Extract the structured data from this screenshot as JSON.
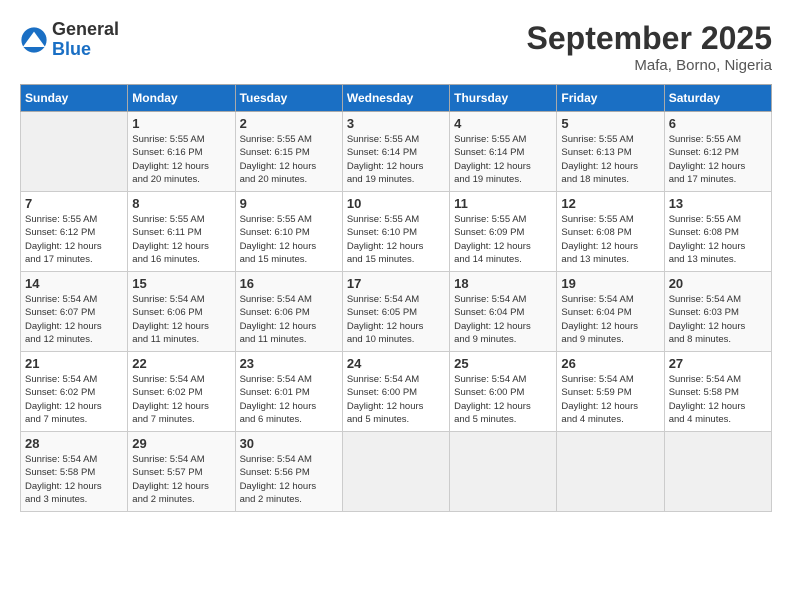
{
  "header": {
    "logo_general": "General",
    "logo_blue": "Blue",
    "month_title": "September 2025",
    "location": "Mafa, Borno, Nigeria"
  },
  "days_of_week": [
    "Sunday",
    "Monday",
    "Tuesday",
    "Wednesday",
    "Thursday",
    "Friday",
    "Saturday"
  ],
  "weeks": [
    [
      {
        "day": "",
        "info": ""
      },
      {
        "day": "1",
        "info": "Sunrise: 5:55 AM\nSunset: 6:16 PM\nDaylight: 12 hours\nand 20 minutes."
      },
      {
        "day": "2",
        "info": "Sunrise: 5:55 AM\nSunset: 6:15 PM\nDaylight: 12 hours\nand 20 minutes."
      },
      {
        "day": "3",
        "info": "Sunrise: 5:55 AM\nSunset: 6:14 PM\nDaylight: 12 hours\nand 19 minutes."
      },
      {
        "day": "4",
        "info": "Sunrise: 5:55 AM\nSunset: 6:14 PM\nDaylight: 12 hours\nand 19 minutes."
      },
      {
        "day": "5",
        "info": "Sunrise: 5:55 AM\nSunset: 6:13 PM\nDaylight: 12 hours\nand 18 minutes."
      },
      {
        "day": "6",
        "info": "Sunrise: 5:55 AM\nSunset: 6:12 PM\nDaylight: 12 hours\nand 17 minutes."
      }
    ],
    [
      {
        "day": "7",
        "info": "Sunrise: 5:55 AM\nSunset: 6:12 PM\nDaylight: 12 hours\nand 17 minutes."
      },
      {
        "day": "8",
        "info": "Sunrise: 5:55 AM\nSunset: 6:11 PM\nDaylight: 12 hours\nand 16 minutes."
      },
      {
        "day": "9",
        "info": "Sunrise: 5:55 AM\nSunset: 6:10 PM\nDaylight: 12 hours\nand 15 minutes."
      },
      {
        "day": "10",
        "info": "Sunrise: 5:55 AM\nSunset: 6:10 PM\nDaylight: 12 hours\nand 15 minutes."
      },
      {
        "day": "11",
        "info": "Sunrise: 5:55 AM\nSunset: 6:09 PM\nDaylight: 12 hours\nand 14 minutes."
      },
      {
        "day": "12",
        "info": "Sunrise: 5:55 AM\nSunset: 6:08 PM\nDaylight: 12 hours\nand 13 minutes."
      },
      {
        "day": "13",
        "info": "Sunrise: 5:55 AM\nSunset: 6:08 PM\nDaylight: 12 hours\nand 13 minutes."
      }
    ],
    [
      {
        "day": "14",
        "info": "Sunrise: 5:54 AM\nSunset: 6:07 PM\nDaylight: 12 hours\nand 12 minutes."
      },
      {
        "day": "15",
        "info": "Sunrise: 5:54 AM\nSunset: 6:06 PM\nDaylight: 12 hours\nand 11 minutes."
      },
      {
        "day": "16",
        "info": "Sunrise: 5:54 AM\nSunset: 6:06 PM\nDaylight: 12 hours\nand 11 minutes."
      },
      {
        "day": "17",
        "info": "Sunrise: 5:54 AM\nSunset: 6:05 PM\nDaylight: 12 hours\nand 10 minutes."
      },
      {
        "day": "18",
        "info": "Sunrise: 5:54 AM\nSunset: 6:04 PM\nDaylight: 12 hours\nand 9 minutes."
      },
      {
        "day": "19",
        "info": "Sunrise: 5:54 AM\nSunset: 6:04 PM\nDaylight: 12 hours\nand 9 minutes."
      },
      {
        "day": "20",
        "info": "Sunrise: 5:54 AM\nSunset: 6:03 PM\nDaylight: 12 hours\nand 8 minutes."
      }
    ],
    [
      {
        "day": "21",
        "info": "Sunrise: 5:54 AM\nSunset: 6:02 PM\nDaylight: 12 hours\nand 7 minutes."
      },
      {
        "day": "22",
        "info": "Sunrise: 5:54 AM\nSunset: 6:02 PM\nDaylight: 12 hours\nand 7 minutes."
      },
      {
        "day": "23",
        "info": "Sunrise: 5:54 AM\nSunset: 6:01 PM\nDaylight: 12 hours\nand 6 minutes."
      },
      {
        "day": "24",
        "info": "Sunrise: 5:54 AM\nSunset: 6:00 PM\nDaylight: 12 hours\nand 5 minutes."
      },
      {
        "day": "25",
        "info": "Sunrise: 5:54 AM\nSunset: 6:00 PM\nDaylight: 12 hours\nand 5 minutes."
      },
      {
        "day": "26",
        "info": "Sunrise: 5:54 AM\nSunset: 5:59 PM\nDaylight: 12 hours\nand 4 minutes."
      },
      {
        "day": "27",
        "info": "Sunrise: 5:54 AM\nSunset: 5:58 PM\nDaylight: 12 hours\nand 4 minutes."
      }
    ],
    [
      {
        "day": "28",
        "info": "Sunrise: 5:54 AM\nSunset: 5:58 PM\nDaylight: 12 hours\nand 3 minutes."
      },
      {
        "day": "29",
        "info": "Sunrise: 5:54 AM\nSunset: 5:57 PM\nDaylight: 12 hours\nand 2 minutes."
      },
      {
        "day": "30",
        "info": "Sunrise: 5:54 AM\nSunset: 5:56 PM\nDaylight: 12 hours\nand 2 minutes."
      },
      {
        "day": "",
        "info": ""
      },
      {
        "day": "",
        "info": ""
      },
      {
        "day": "",
        "info": ""
      },
      {
        "day": "",
        "info": ""
      }
    ]
  ]
}
